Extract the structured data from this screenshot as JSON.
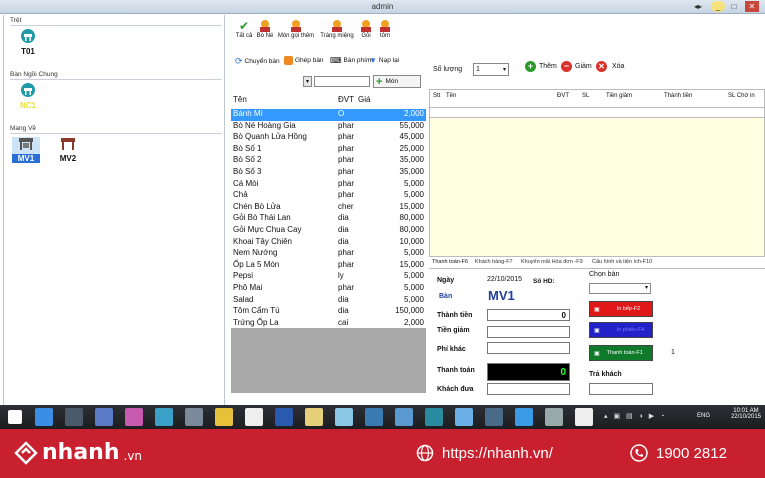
{
  "window": {
    "title": "admin"
  },
  "areas": [
    {
      "label": "Trệt",
      "tables": [
        "T01"
      ]
    },
    {
      "label": "Bàn Ngồi Chung",
      "tables": [
        "NC1"
      ]
    },
    {
      "label": "Mang Về",
      "tables": [
        "MV1",
        "MV2"
      ]
    }
  ],
  "toolbar": {
    "items": [
      "Tất cả",
      "Bò Né",
      "Món gọi thêm",
      "Tráng miệng",
      "Gỏi",
      "tôm"
    ]
  },
  "actions": {
    "move_table": "Chuyển bàn",
    "merge_table": "Ghép bàn",
    "keyboard": "Bàn phím",
    "reload": "Nạp lại",
    "add_dish": "Món"
  },
  "menu_list": {
    "headers": {
      "name": "Tên",
      "unit": "ĐVT",
      "price": "Giá"
    },
    "items": [
      {
        "name": "Bánh Mì",
        "unit": "O",
        "price": "2,000",
        "selected": true
      },
      {
        "name": "Bò Né Hoàng Gia",
        "unit": "phar",
        "price": "55,000"
      },
      {
        "name": "Bò Quanh Lửa Hồng",
        "unit": "phar",
        "price": "45,000"
      },
      {
        "name": "Bò Số 1",
        "unit": "phar",
        "price": "25,000"
      },
      {
        "name": "Bò Số 2",
        "unit": "phar",
        "price": "35,000"
      },
      {
        "name": "Bò Số 3",
        "unit": "phar",
        "price": "35,000"
      },
      {
        "name": "Cá Mòi",
        "unit": "phar",
        "price": "5,000"
      },
      {
        "name": "Chả",
        "unit": "phar",
        "price": "5,000"
      },
      {
        "name": "Chén Bò Lửa",
        "unit": "cher",
        "price": "15,000"
      },
      {
        "name": "Gỏi Bò Thái Lan",
        "unit": "dia",
        "price": "80,000"
      },
      {
        "name": "Gỏi Mực Chua Cay",
        "unit": "dia",
        "price": "80,000"
      },
      {
        "name": "Khoai Tây Chiên",
        "unit": "dia",
        "price": "10,000"
      },
      {
        "name": "Nem Nướng",
        "unit": "phar",
        "price": "5,000"
      },
      {
        "name": "Ốp La 5 Món",
        "unit": "phar",
        "price": "15,000"
      },
      {
        "name": "Pepsi",
        "unit": "ly",
        "price": "5,000"
      },
      {
        "name": "Phô Mai",
        "unit": "phar",
        "price": "5,000"
      },
      {
        "name": "Salad",
        "unit": "dia",
        "price": "5,000"
      },
      {
        "name": "Tôm Cẩm Tú",
        "unit": "dia",
        "price": "150,000"
      },
      {
        "name": "Trứng Ốp La",
        "unit": "cai",
        "price": "2,000"
      }
    ]
  },
  "order": {
    "qty_label": "Số lượng",
    "qty_value": "1",
    "add": "Thêm",
    "decrease": "Giảm",
    "delete": "Xóa",
    "headers": [
      "Stt",
      "Tên",
      "ĐVT",
      "SL",
      "Tiền giảm",
      "Thành tiền",
      "SL Chờ in"
    ]
  },
  "payment_tabs": [
    "Thanh toán-F6",
    "Khách hàng-F7",
    "Khuyến mãi Hóa đơn -F9",
    "Cấu hình và tiện ích-F10"
  ],
  "payment": {
    "date_label": "Ngày",
    "date_value": "22/10/2015",
    "invoice_label": "Số HD:",
    "table_label": "Bàn",
    "table_value": "MV1",
    "total_label": "Thành tiền",
    "total_value": "0",
    "discount_label": "Tiền giảm",
    "extra_label": "Phí khác",
    "pay_label": "Thanh toán",
    "pay_value": "0",
    "cash_label": "Khách đưa",
    "choose_table": "Chọn bàn",
    "kitchen_btn": "In bếp-F2",
    "print_btn": "In phiếu-F4",
    "checkout_btn": "Thanh toán-F1",
    "checkout_count": "1",
    "change_label": "Trả khách"
  },
  "taskbar": {
    "lang": "ENG",
    "time": "10:01 AM",
    "date": "22/10/2015"
  },
  "banner": {
    "brand": "nhanh",
    "brand_suffix": ".vn",
    "site": "https://nhanh.vn/",
    "phone": "1900 2812",
    "color": "#c8202f"
  }
}
